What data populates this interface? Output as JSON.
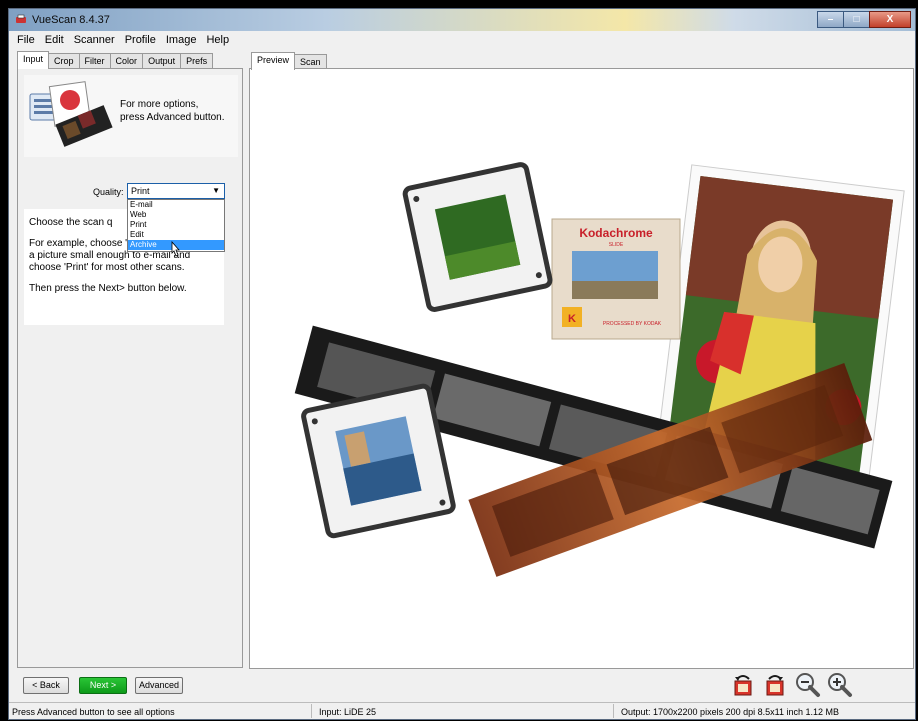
{
  "window": {
    "title": "VueScan 8.4.37",
    "buttons": {
      "minimize": "–",
      "maximize": "□",
      "close": "X"
    }
  },
  "menu": [
    "File",
    "Edit",
    "Scanner",
    "Profile",
    "Image",
    "Help"
  ],
  "left_tabs": [
    {
      "label": "Input",
      "active": true
    },
    {
      "label": "Crop",
      "active": false
    },
    {
      "label": "Filter",
      "active": false
    },
    {
      "label": "Color",
      "active": false
    },
    {
      "label": "Output",
      "active": false
    },
    {
      "label": "Prefs",
      "active": false
    }
  ],
  "intro": {
    "line1": "For more options,",
    "line2": "press Advanced button."
  },
  "quality": {
    "label": "Quality:",
    "value": "Print",
    "options": [
      "E-mail",
      "Web",
      "Print",
      "Edit",
      "Archive"
    ],
    "highlighted": "Archive"
  },
  "help": {
    "p1": "Choose the scan q",
    "p2a": "For example, choose 'E-mail' to scan",
    "p2b": "a picture small enough to e-mail and",
    "p2c": "choose 'Print' for most other scans.",
    "p3": "Then press the Next> button below."
  },
  "right_tabs": [
    {
      "label": "Preview",
      "active": true
    },
    {
      "label": "Scan",
      "active": false
    }
  ],
  "preview": {
    "slide_brand": "Kodachrome",
    "slide_sub": "SLIDE",
    "slide_footer": "PROCESSED BY KODAK",
    "slide_logo": "K"
  },
  "bottom_buttons": {
    "back": "< Back",
    "next": "Next >",
    "advanced": "Advanced"
  },
  "toolbar_icons": [
    "rotate-left-icon",
    "rotate-right-icon",
    "zoom-out-icon",
    "zoom-in-icon"
  ],
  "status": {
    "left": "Press Advanced button to see all options",
    "middle": "Input: LiDE 25",
    "right": "Output: 1700x2200 pixels 200 dpi 8.5x11 inch 1.12 MB"
  },
  "colors": {
    "accent": "#3399ff",
    "next_button": "#13a820",
    "select_border": "#1b5fa8"
  }
}
